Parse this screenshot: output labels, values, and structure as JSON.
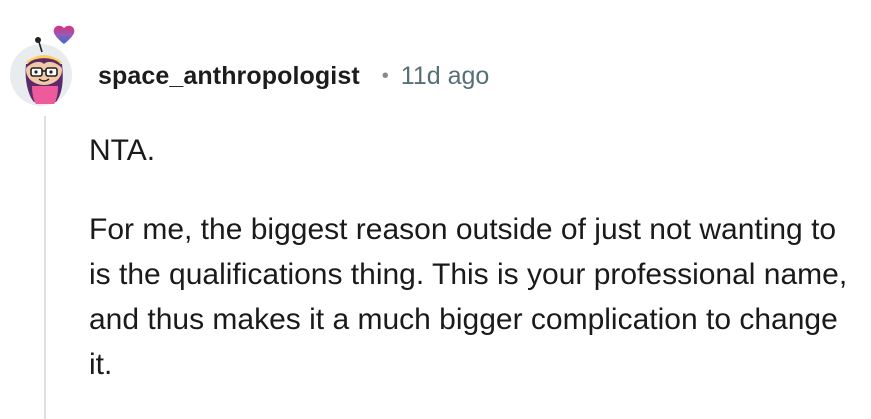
{
  "comment": {
    "username": "space_anthropologist",
    "separator": "•",
    "timestamp": "11d ago",
    "paragraphs": [
      "NTA.",
      "For me, the biggest reason outside of just not wanting to is the qualifications thing. This is your professional name, and thus makes it a much bigger complication to change it."
    ]
  },
  "icons": {
    "avatar": "snoo-avatar-icon",
    "flair": "bi-heart-flair-icon"
  },
  "colors": {
    "username": "#1c1c1c",
    "timestamp": "#576f76",
    "thread_line": "#e0e0e0",
    "heart_top": "#d6337a",
    "heart_middle": "#9b59b6",
    "heart_bottom": "#2b6fd6"
  }
}
